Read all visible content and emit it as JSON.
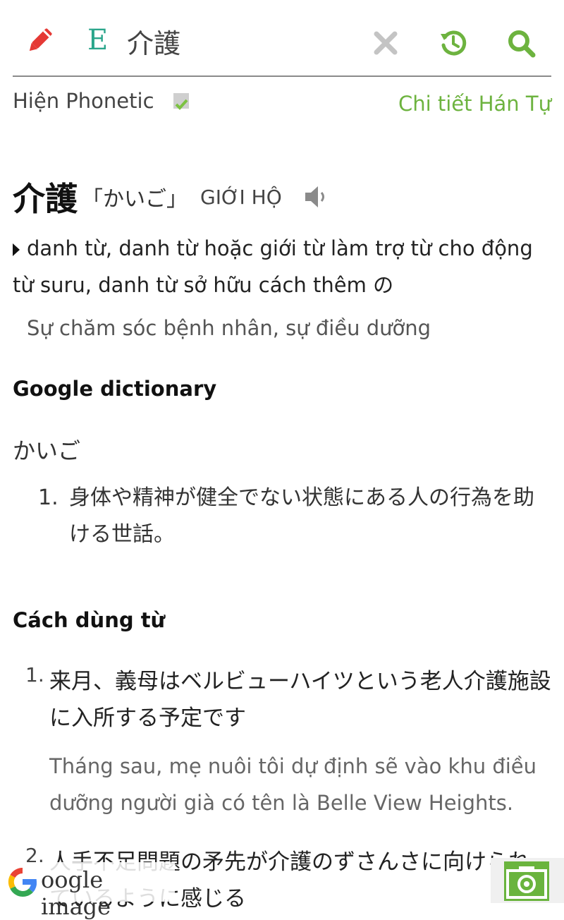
{
  "search": {
    "value": "介護",
    "language_code": "E"
  },
  "options": {
    "show_phonetic_label": "Hiện Phonetic",
    "show_phonetic_checked": true,
    "kanji_detail_link": "Chi tiết Hán Tự"
  },
  "entry": {
    "word": "介護",
    "reading": "「かいご」",
    "han_viet": "GIỚI HỘ",
    "part_of_speech": "danh từ, danh từ hoặc giới từ làm trợ từ cho động từ suru, danh từ sở hữu cách thêm の",
    "meaning": "Sự chăm sóc bệnh nhân, sự điều dưỡng"
  },
  "google_dictionary": {
    "title": "Google dictionary",
    "reading": "かいご",
    "definitions": [
      {
        "num": "1.",
        "text": "身体や精神が健全でない状態にある人の行為を助ける世話。"
      }
    ]
  },
  "usage": {
    "title": "Cách dùng từ",
    "examples": [
      {
        "num": "1.",
        "jp": "来月、義母はベルビューハイツという老人介護施設に入所する予定です",
        "vi": "Tháng sau, mẹ nuôi tôi dự định sẽ vào khu điều dưỡng người già có tên là Belle View Heights."
      },
      {
        "num": "2.",
        "jp": "人手不足問題の矛先が介護のずさんさに向けられているように感じる",
        "vi": ""
      }
    ]
  },
  "footer": {
    "google_image_label": "oogle image"
  },
  "colors": {
    "accent_green": "#6db33f",
    "teal": "#2aa58b",
    "pencil_red": "#e53935"
  }
}
